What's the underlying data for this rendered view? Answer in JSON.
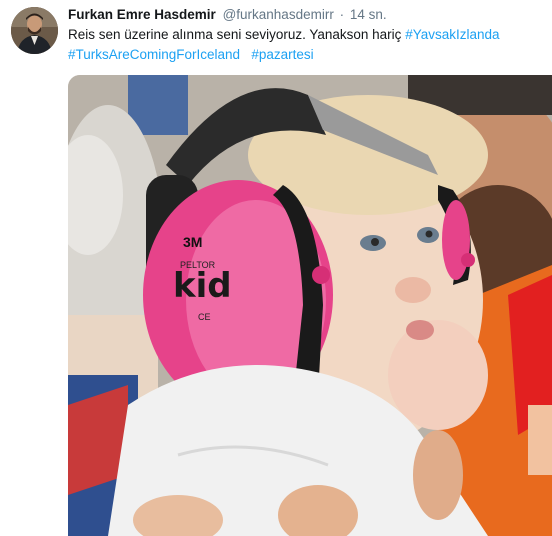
{
  "tweet": {
    "author_name": "Furkan Emre Hasdemir",
    "author_handle": "@furkanhasdemirr",
    "separator": "·",
    "timestamp": "14 sn.",
    "text_main": "Reis sen üzerine alınma seni seviyoruz. Yanakson hariç",
    "hashtags": [
      "#YavsakIzlanda",
      "#TurksAreComingForIceland",
      "#pazartesi"
    ]
  },
  "media": {
    "ear_cup_brand": "3M",
    "ear_cup_model": "PELTOR",
    "ear_cup_label": "kid",
    "ear_cup_mark": "CE"
  },
  "colors": {
    "name": "#14171a",
    "secondary": "#657786",
    "link": "#1da1f2",
    "earmuff_pink": "#e6438a"
  },
  "icons": {
    "avatar": "avatar-photo"
  }
}
